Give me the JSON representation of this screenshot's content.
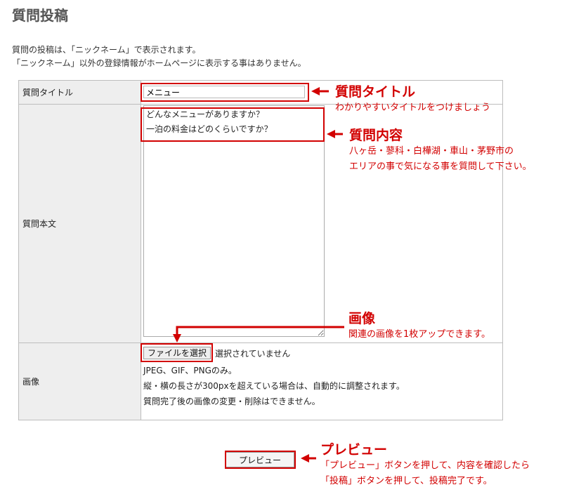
{
  "page": {
    "title": "質問投稿"
  },
  "intro": {
    "line1": "質問の投稿は、「ニックネーム」で表示されます。",
    "line2": "「ニックネーム」以外の登録情報がホームページに表示する事はありません。"
  },
  "form": {
    "title_label": "質問タイトル",
    "title_value": "メニュー",
    "body_label": "質問本文",
    "body_value": "どんなメニューがありますか？\n一泊の料金はどのくらいですか？",
    "image_label": "画像",
    "file_button": "ファイルを選択",
    "file_status": "選択されていません",
    "note1": "JPEG、GIF、PNGのみ。",
    "note2": "縦・横の長さが300pxを超えている場合は、自動的に調整されます。",
    "note3": "質問完了後の画像の変更・削除はできません。",
    "preview_button": "プレビュー"
  },
  "annotations": {
    "title": {
      "heading": "質問タイトル",
      "desc": "わかりやすいタイトルをつけましょう"
    },
    "body": {
      "heading": "質問内容",
      "desc1": "八ヶ岳・蓼科・白樺湖・車山・茅野市の",
      "desc2": "エリアの事で気になる事を質問して下さい。"
    },
    "image": {
      "heading": "画像",
      "desc": "関連の画像を1枚アップできます。"
    },
    "preview": {
      "heading": "プレビュー",
      "desc1": "「プレビュー」ボタンを押して、内容を確認したら",
      "desc2": "「投稿」ボタンを押して、投稿完了です。"
    },
    "color": "#d20000"
  }
}
